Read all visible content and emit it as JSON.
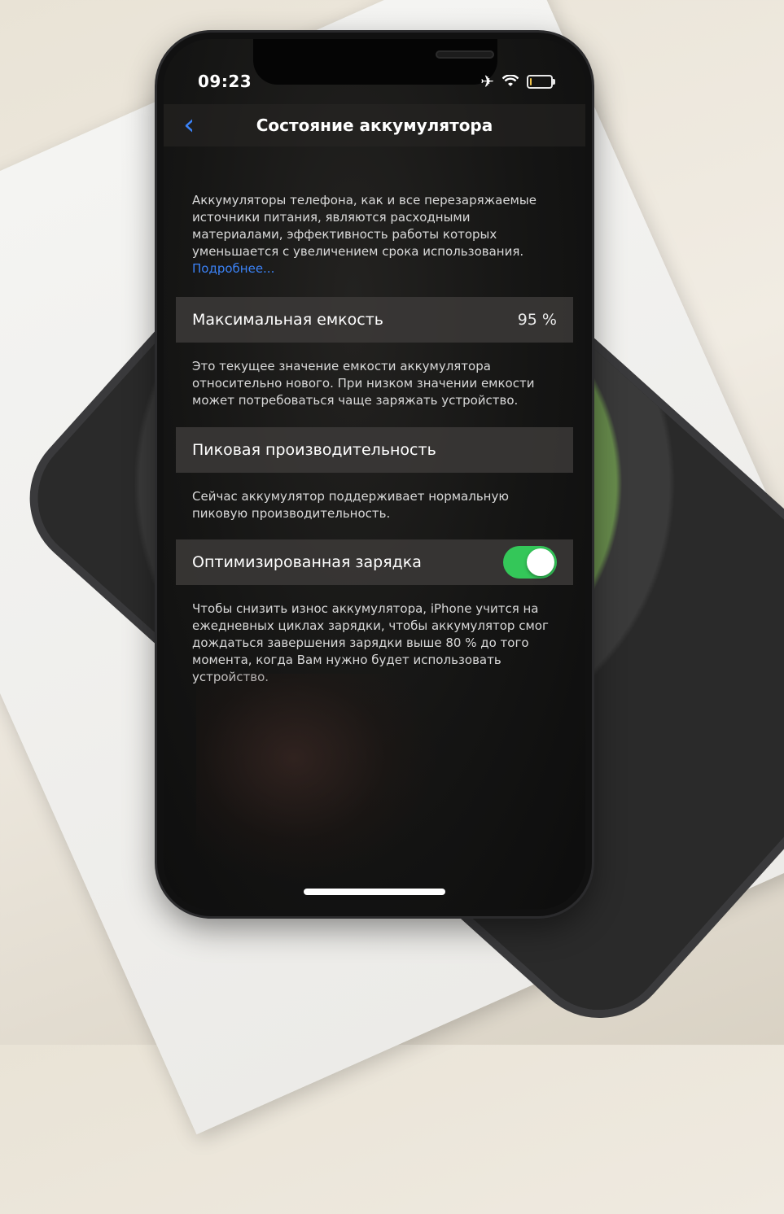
{
  "status_bar": {
    "time": "09:23",
    "icons": [
      "airplane-icon",
      "wifi-icon",
      "battery-icon"
    ]
  },
  "nav": {
    "back_icon": "chevron-left-icon",
    "title": "Состояние аккумулятора"
  },
  "intro": {
    "text": "Аккумуляторы телефона, как и все перезаряжаемые источники питания, являются расходными материалами, эффективность работы которых уменьшается с увеличением срока использования.",
    "link": "Подробнее..."
  },
  "max_capacity": {
    "label": "Максимальная емкость",
    "value": "95 %",
    "description": "Это текущее значение емкости аккумулятора относительно нового. При низком значении емкости может потребоваться чаще заряжать устройство."
  },
  "peak_performance": {
    "label": "Пиковая производительность",
    "description": "Сейчас аккумулятор поддерживает нормальную пиковую производительность."
  },
  "optimized_charging": {
    "label": "Оптимизированная зарядка",
    "enabled": true,
    "description": "Чтобы снизить износ аккумулятора, iPhone учится на ежедневных циклах зарядки, чтобы аккумулятор смог дождаться завершения зарядки выше 80 % до того момента, когда Вам нужно будет использовать устройство."
  },
  "colors": {
    "accent": "#3b82f6",
    "toggle_on": "#34c759"
  }
}
